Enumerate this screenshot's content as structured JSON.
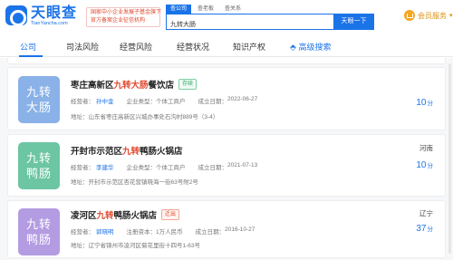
{
  "header": {
    "logo_cn": "天眼查",
    "logo_en": "TianYancha.com",
    "badge_line1": "国家中小企业发展子基金旗下",
    "badge_line2": "官方备案企业征信机构",
    "search_tabs": [
      "查公司",
      "查老板",
      "查关系"
    ],
    "search_value": "九转大肠",
    "search_button": "天眼一下",
    "vip_label": "会员服务"
  },
  "nav": {
    "items": [
      "公司",
      "司法风险",
      "经营风险",
      "经营状况",
      "知识产权"
    ],
    "advanced": "高级搜索"
  },
  "results": [
    {
      "thumb": [
        "九转",
        "大肠"
      ],
      "title_pre": "枣庄高新区",
      "title_hl": "九转大肠",
      "title_post": "餐饮店",
      "status": "存续",
      "legal_label": "经营者：",
      "legal_person": "孙中金",
      "type_label": "企业类型：",
      "type": "个体工商户",
      "date_label": "成立日期：",
      "date": "2022-06-27",
      "address_label": "地址：",
      "address": "山东省枣庄高新区兴城办事处石沟村889号（3-4）",
      "region": "",
      "score": "10",
      "score_unit": "分"
    },
    {
      "thumb": [
        "九转",
        "鸭肠"
      ],
      "title_pre": "开封市示范区",
      "title_hl": "九转",
      "title_post": "鸭肠火锅店",
      "status": "存续",
      "legal_label": "经营者：",
      "legal_person": "李建华",
      "type_label": "企业类型：",
      "type": "个体工商户",
      "date_label": "成立日期：",
      "date": "2021-07-13",
      "address_label": "地址：",
      "address": "开封市示范区杏花营镇晓海一街63号附2号",
      "region": "河南",
      "score": "10",
      "score_unit": "分"
    },
    {
      "thumb": [
        "九转",
        "鸭肠"
      ],
      "title_pre": "凌河区",
      "title_hl": "九转",
      "title_post": "鸭肠火锅店",
      "status": "迁出",
      "legal_label": "经营者：",
      "legal_person": "郭晓明",
      "type_label": "注册资本：",
      "type": "1万人民币",
      "date_label": "成立日期：",
      "date": "2016-10-27",
      "address_label": "地址：",
      "address": "辽宁省锦州市凌河区菊花里街十四号1-63号",
      "region": "辽宁",
      "score": "37",
      "score_unit": "分"
    }
  ]
}
